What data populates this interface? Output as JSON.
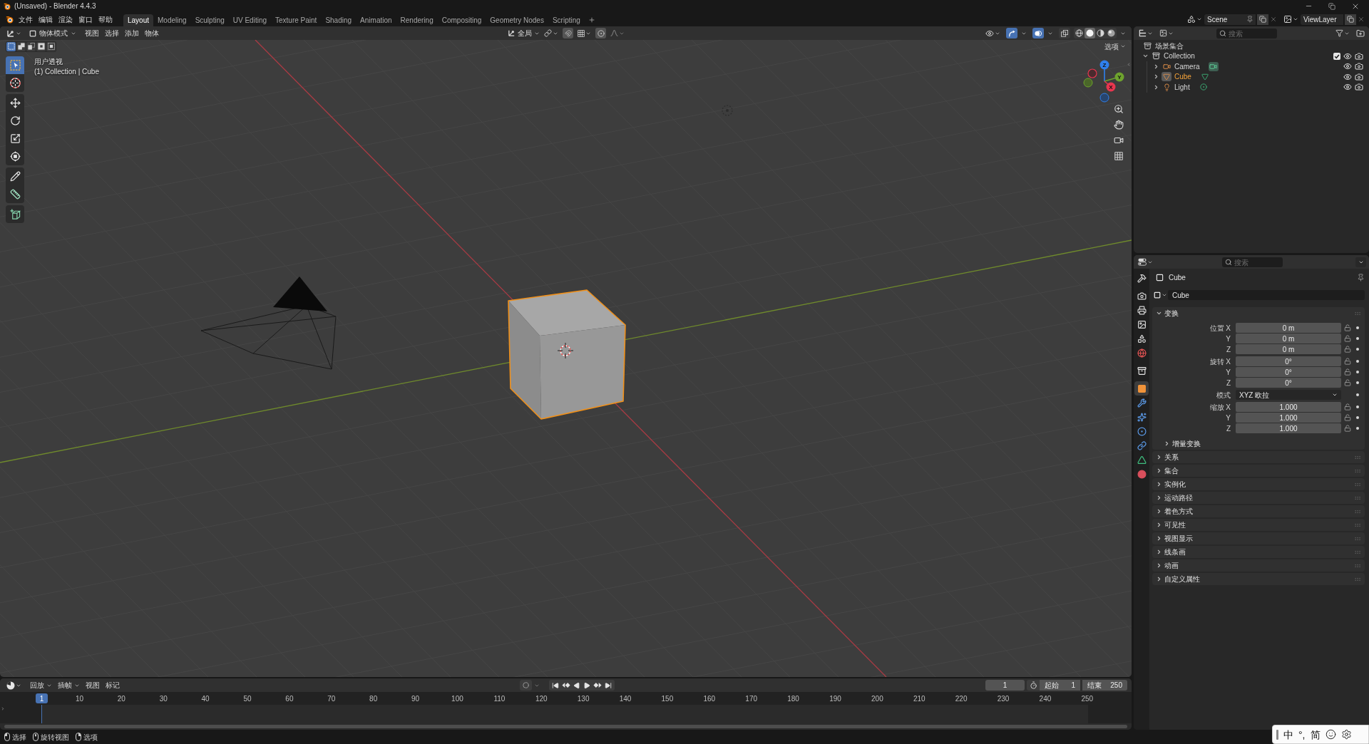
{
  "window": {
    "title": "(Unsaved) - Blender 4.4.3"
  },
  "menu": [
    "文件",
    "编辑",
    "渲染",
    "窗口",
    "帮助"
  ],
  "workspaces": [
    {
      "label": "Layout",
      "selected": true
    },
    {
      "label": "Modeling",
      "selected": false
    },
    {
      "label": "Sculpting",
      "selected": false
    },
    {
      "label": "UV Editing",
      "selected": false
    },
    {
      "label": "Texture Paint",
      "selected": false
    },
    {
      "label": "Shading",
      "selected": false
    },
    {
      "label": "Animation",
      "selected": false
    },
    {
      "label": "Rendering",
      "selected": false
    },
    {
      "label": "Compositing",
      "selected": false
    },
    {
      "label": "Geometry Nodes",
      "selected": false
    },
    {
      "label": "Scripting",
      "selected": false
    }
  ],
  "scene_selector": {
    "scene": "Scene",
    "view_layer": "ViewLayer"
  },
  "viewport": {
    "mode": "物体模式",
    "menus": [
      "视图",
      "选择",
      "添加",
      "物体"
    ],
    "orientation": "全局",
    "select_modes": [
      {
        "kind": "set",
        "selected": true
      },
      {
        "kind": "extend",
        "selected": false
      },
      {
        "kind": "subtract",
        "selected": false
      },
      {
        "kind": "difference",
        "selected": false
      },
      {
        "kind": "intersect",
        "selected": false
      }
    ],
    "shading": [
      {
        "kind": "wireframe",
        "selected": false
      },
      {
        "kind": "solid",
        "selected": true
      },
      {
        "kind": "material",
        "selected": false
      },
      {
        "kind": "rendered",
        "selected": false
      }
    ],
    "options": "选项",
    "view_name": "用户透视",
    "context": "(1) Collection | Cube",
    "tool_groups": [
      [
        {
          "kind": "select_box",
          "selected": true
        },
        {
          "kind": "cursor",
          "selected": false
        }
      ],
      [
        {
          "kind": "move",
          "selected": false
        },
        {
          "kind": "rotate",
          "selected": false
        },
        {
          "kind": "scale",
          "selected": false
        },
        {
          "kind": "transform",
          "selected": false
        }
      ],
      [
        {
          "kind": "annotate",
          "selected": false
        },
        {
          "kind": "measure",
          "selected": false
        }
      ],
      [
        {
          "kind": "add_cube",
          "selected": false
        }
      ]
    ],
    "gizmo_axes": [
      "X",
      "Y",
      "Z"
    ]
  },
  "outliner": {
    "search_placeholder": "搜索",
    "tree": [
      {
        "label": "场景集合",
        "kind": "scene_collection",
        "selected": false,
        "children": [
          {
            "label": "Collection",
            "kind": "collection",
            "selected": false,
            "expanded": true,
            "checked": true,
            "children": [
              {
                "label": "Camera",
                "kind": "camera",
                "selected": false,
                "expanded": false
              },
              {
                "label": "Cube",
                "kind": "mesh",
                "selected": true,
                "expanded": false
              },
              {
                "label": "Light",
                "kind": "light",
                "selected": false,
                "expanded": false
              }
            ]
          }
        ]
      }
    ]
  },
  "properties": {
    "search_placeholder": "搜索",
    "tab_groups": [
      [
        {
          "kind": "tool",
          "selected": false
        }
      ],
      [
        {
          "kind": "render",
          "selected": false
        },
        {
          "kind": "output",
          "selected": false
        },
        {
          "kind": "view_layer",
          "selected": false
        },
        {
          "kind": "scene",
          "selected": false
        },
        {
          "kind": "world",
          "selected": false
        }
      ],
      [
        {
          "kind": "collection",
          "selected": false
        }
      ],
      [
        {
          "kind": "object",
          "selected": true
        },
        {
          "kind": "modifiers",
          "selected": false
        },
        {
          "kind": "particles",
          "selected": false
        },
        {
          "kind": "physics",
          "selected": false
        },
        {
          "kind": "constraints",
          "selected": false
        },
        {
          "kind": "data",
          "selected": false
        },
        {
          "kind": "material",
          "selected": false
        }
      ]
    ],
    "title": "Cube",
    "name": "Cube",
    "panels": [
      {
        "label": "变换",
        "expanded": true,
        "groups": [
          [
            {
              "label": "位置 X",
              "value": "0 m",
              "kind": "number"
            },
            {
              "label": "Y",
              "value": "0 m",
              "kind": "number"
            },
            {
              "label": "Z",
              "value": "0 m",
              "kind": "number"
            }
          ],
          [
            {
              "label": "旋转 X",
              "value": "0°",
              "kind": "number"
            },
            {
              "label": "Y",
              "value": "0°",
              "kind": "number"
            },
            {
              "label": "Z",
              "value": "0°",
              "kind": "number"
            }
          ],
          [
            {
              "label": "模式",
              "value": "XYZ 欧拉",
              "kind": "dropdown"
            }
          ],
          [
            {
              "label": "缩放 X",
              "value": "1.000",
              "kind": "number"
            },
            {
              "label": "Y",
              "value": "1.000",
              "kind": "number"
            },
            {
              "label": "Z",
              "value": "1.000",
              "kind": "number"
            }
          ]
        ],
        "subpanels": [
          {
            "label": "增量变换",
            "expanded": false
          }
        ]
      },
      {
        "label": "关系",
        "expanded": false
      },
      {
        "label": "集合",
        "expanded": false
      },
      {
        "label": "实例化",
        "expanded": false
      },
      {
        "label": "运动路径",
        "expanded": false
      },
      {
        "label": "着色方式",
        "expanded": false
      },
      {
        "label": "可见性",
        "expanded": false
      },
      {
        "label": "视图显示",
        "expanded": false
      },
      {
        "label": "线条画",
        "expanded": false
      },
      {
        "label": "动画",
        "expanded": false
      },
      {
        "label": "自定义属性",
        "expanded": false
      }
    ]
  },
  "timeline": {
    "menus": [
      {
        "label": "回放",
        "kind": "dropdown"
      },
      {
        "label": "插帧",
        "kind": "dropdown"
      },
      {
        "label": "视图",
        "kind": "menu"
      },
      {
        "label": "标记",
        "kind": "menu"
      }
    ],
    "current_frame": "1",
    "start_label": "起始",
    "start": "1",
    "end_label": "结束",
    "end": "250",
    "playhead": "1",
    "ruler": [
      "10",
      "20",
      "30",
      "40",
      "50",
      "60",
      "70",
      "80",
      "90",
      "100",
      "110",
      "120",
      "130",
      "140",
      "150",
      "160",
      "170",
      "180",
      "190",
      "200",
      "210",
      "220",
      "230",
      "240",
      "250"
    ]
  },
  "status_bar": [
    {
      "label": "选择",
      "kind": "left_click"
    },
    {
      "label": "旋转视图",
      "kind": "middle_click"
    },
    {
      "label": "选项",
      "kind": "right_click"
    }
  ],
  "ime_toolbar": [
    "中",
    "°,",
    "简"
  ]
}
